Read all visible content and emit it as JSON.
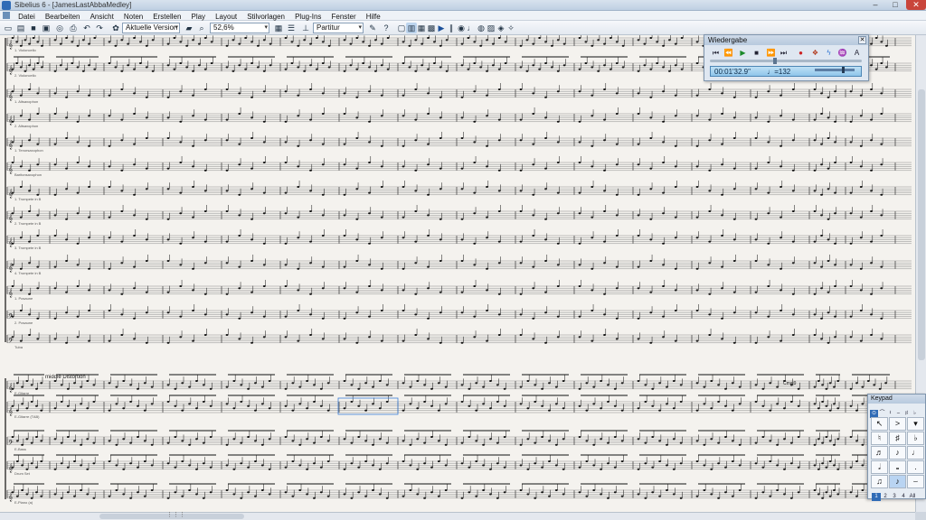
{
  "window": {
    "title": "Sibelius 6 - [JamesLastAbbaMedley]",
    "min_label": "–",
    "max_label": "□",
    "close_label": "✕"
  },
  "menu": [
    "Datei",
    "Bearbeiten",
    "Ansicht",
    "Noten",
    "Erstellen",
    "Play",
    "Layout",
    "Stilvorlagen",
    "Plug-Ins",
    "Fenster",
    "Hilfe"
  ],
  "toolbar": {
    "version_combo": "Aktuelle Version",
    "zoom_combo": "52,6%",
    "view_combo": "Partitur"
  },
  "score": {
    "instruments": [
      "1. Violoncello",
      "2. Violoncello",
      "1. Altsaxophon",
      "2. Altsaxophon",
      "1. Tenorsaxophon",
      "Baritonsaxophon",
      "1. Trompete in B",
      "2. Trompete in B",
      "3. Trompete in B",
      "4. Trompete in B",
      "1. Posaune",
      "2. Posaune",
      "Tuba",
      "E-Gitarre",
      "E-Gitarre (TAB)",
      "E-Bass",
      "Drum Set",
      "E-Piano (a)"
    ],
    "marks": {
      "distortion": "middle Distortion",
      "chord_right": "Cmaj9"
    }
  },
  "playback": {
    "title": "Wiedergabe",
    "close_label": "✕",
    "time": "00:01'32.9\"",
    "tempo": "♩=132"
  },
  "keypad": {
    "title": "Keypad",
    "layouts": [
      "1",
      "2",
      "3",
      "4",
      "All"
    ]
  },
  "colors": {
    "selection_blue": "#3b7dd8",
    "titlebar": "#c7d6e7",
    "paper": "#f4f2ee"
  },
  "icons": {
    "toolbar": [
      "new-icon",
      "open-icon",
      "save-icon",
      "print-icon",
      "undo-icon",
      "redo-icon",
      "mixer-icon",
      "zoom-icon",
      "navigator-icon",
      "help-icon",
      "play-icon"
    ],
    "playback": [
      "rewind-start-icon",
      "rewind-icon",
      "play-icon",
      "stop-icon",
      "fast-forward-icon",
      "forward-end-icon",
      "record-icon",
      "live-tempo-icon",
      "live-playback-icon",
      "interpretation-icon"
    ]
  }
}
